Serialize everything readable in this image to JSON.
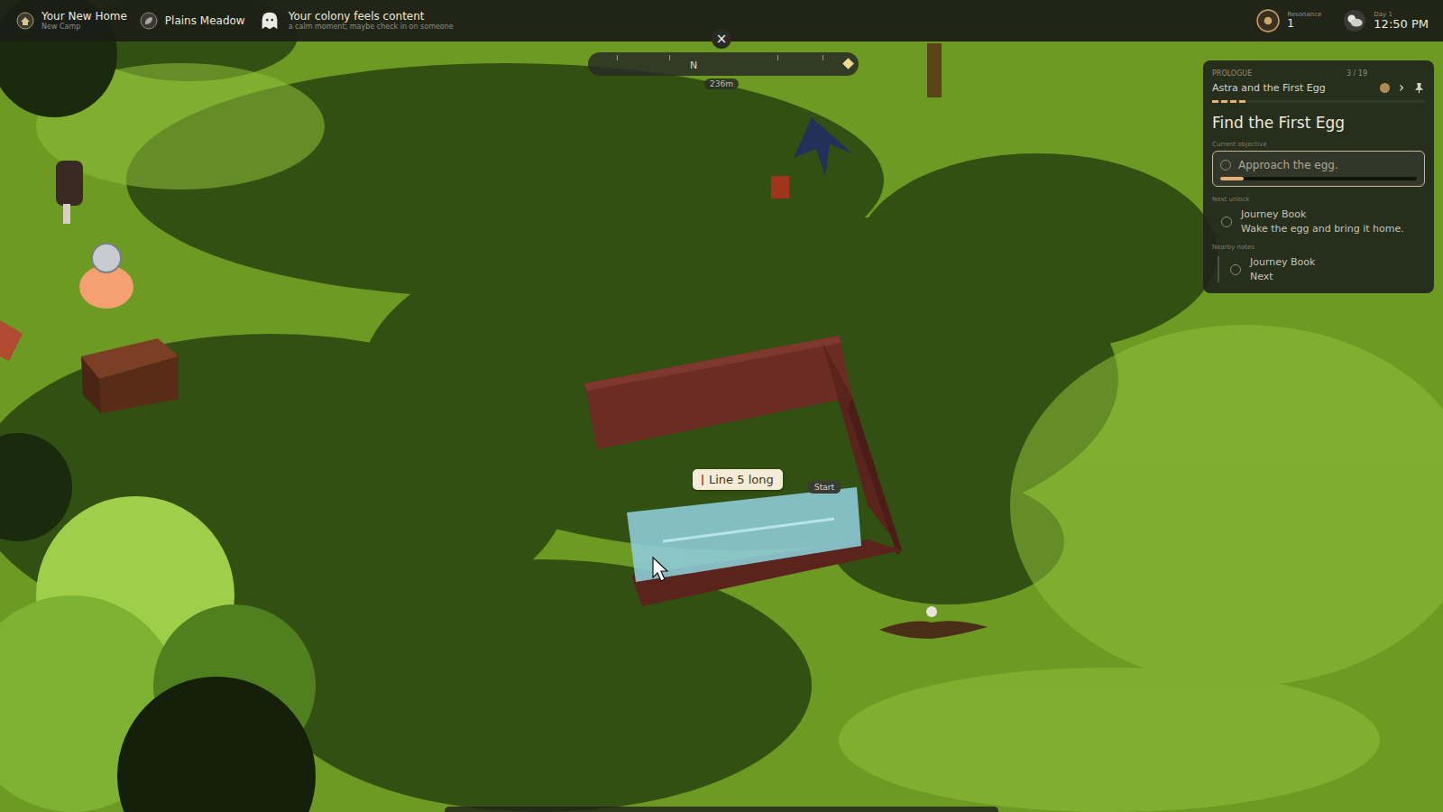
{
  "top_bar": {
    "location": {
      "title": "Your New Home",
      "subtitle": "New Camp"
    },
    "biome": "Plains Meadow",
    "mood": {
      "title": "Your colony feels content",
      "subtitle": "a calm moment; maybe check in on someone"
    },
    "resonance": {
      "label": "Resonance",
      "value": "1"
    },
    "clock": {
      "day": "Day 1",
      "time": "12:50 PM"
    }
  },
  "compass": {
    "close": "×",
    "heading": "N",
    "distance": "236m"
  },
  "quest": {
    "chapter": "PROLOGUE",
    "count": "3 / 19",
    "next_symbol": "›",
    "title": "Astra and the First Egg",
    "chapter_level": 0.16,
    "goal": "Find the First Egg",
    "objective_label": "Current objective",
    "objective": {
      "text": "Approach the egg.",
      "level": 0.12
    },
    "unlock_label": "Next unlock",
    "unlock": {
      "title": "Journey Book",
      "detail": "Wake the egg and bring it home."
    },
    "notes_label": "Nearby notes",
    "notes": [
      {
        "title": "Journey Book",
        "detail": "Next"
      }
    ]
  },
  "build": {
    "tooltip": "Line 5 long",
    "start_label": "Start"
  }
}
